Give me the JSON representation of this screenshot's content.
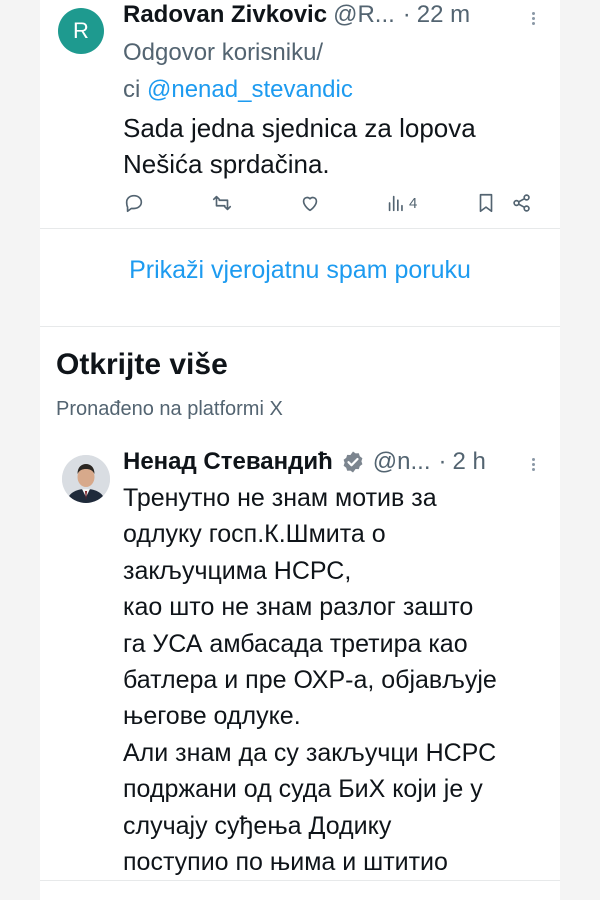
{
  "tweet1": {
    "avatar_letter": "R",
    "author_name": "Radovan Zivkovic",
    "author_handle": "@R...",
    "separator": "·",
    "time": "22 m",
    "reply_label_line1": "Odgovor korisniku/",
    "reply_label_line2_prefix": "ci ",
    "reply_mention": "@nenad_stevandic",
    "text_line1": "Sada jedna sjednica za lopova",
    "text_line2": "Nešića sprdačina.",
    "actions": {
      "views_count": "4"
    }
  },
  "spam_link": "Prikaži vjerojatnu spam poruku",
  "discover": {
    "title": "Otkrijte više",
    "subtitle": "Pronađeno na platformi X"
  },
  "tweet2": {
    "author_name": "Ненад Стевандић",
    "author_handle": "@n...",
    "separator": "·",
    "time": "2 h",
    "lines": [
      "Тренутно не знам мотив за",
      "одлуку госп.К.Шмита о",
      "закључцима НСРС,",
      "као што не знам разлог зашто",
      "га УСА амбасада третира као",
      "батлера и пре  ОХР-а, објављује",
      "његове одлуке.",
      "Али знам да су закључци НСРС",
      "подржани од суда БиХ који је у",
      "случају суђења Додику",
      "поступио по њима и штитио"
    ]
  },
  "colors": {
    "accent": "#1d9bf0",
    "muted": "#536471",
    "text": "#0f1419",
    "avatar_r": "#1e9a8f"
  },
  "icons": {
    "reply": "reply-icon",
    "repost": "repost-icon",
    "like": "like-icon",
    "views": "views-icon",
    "bookmark": "bookmark-icon",
    "share": "share-icon",
    "verified": "verified-badge-icon",
    "more": "more-dots-icon"
  }
}
